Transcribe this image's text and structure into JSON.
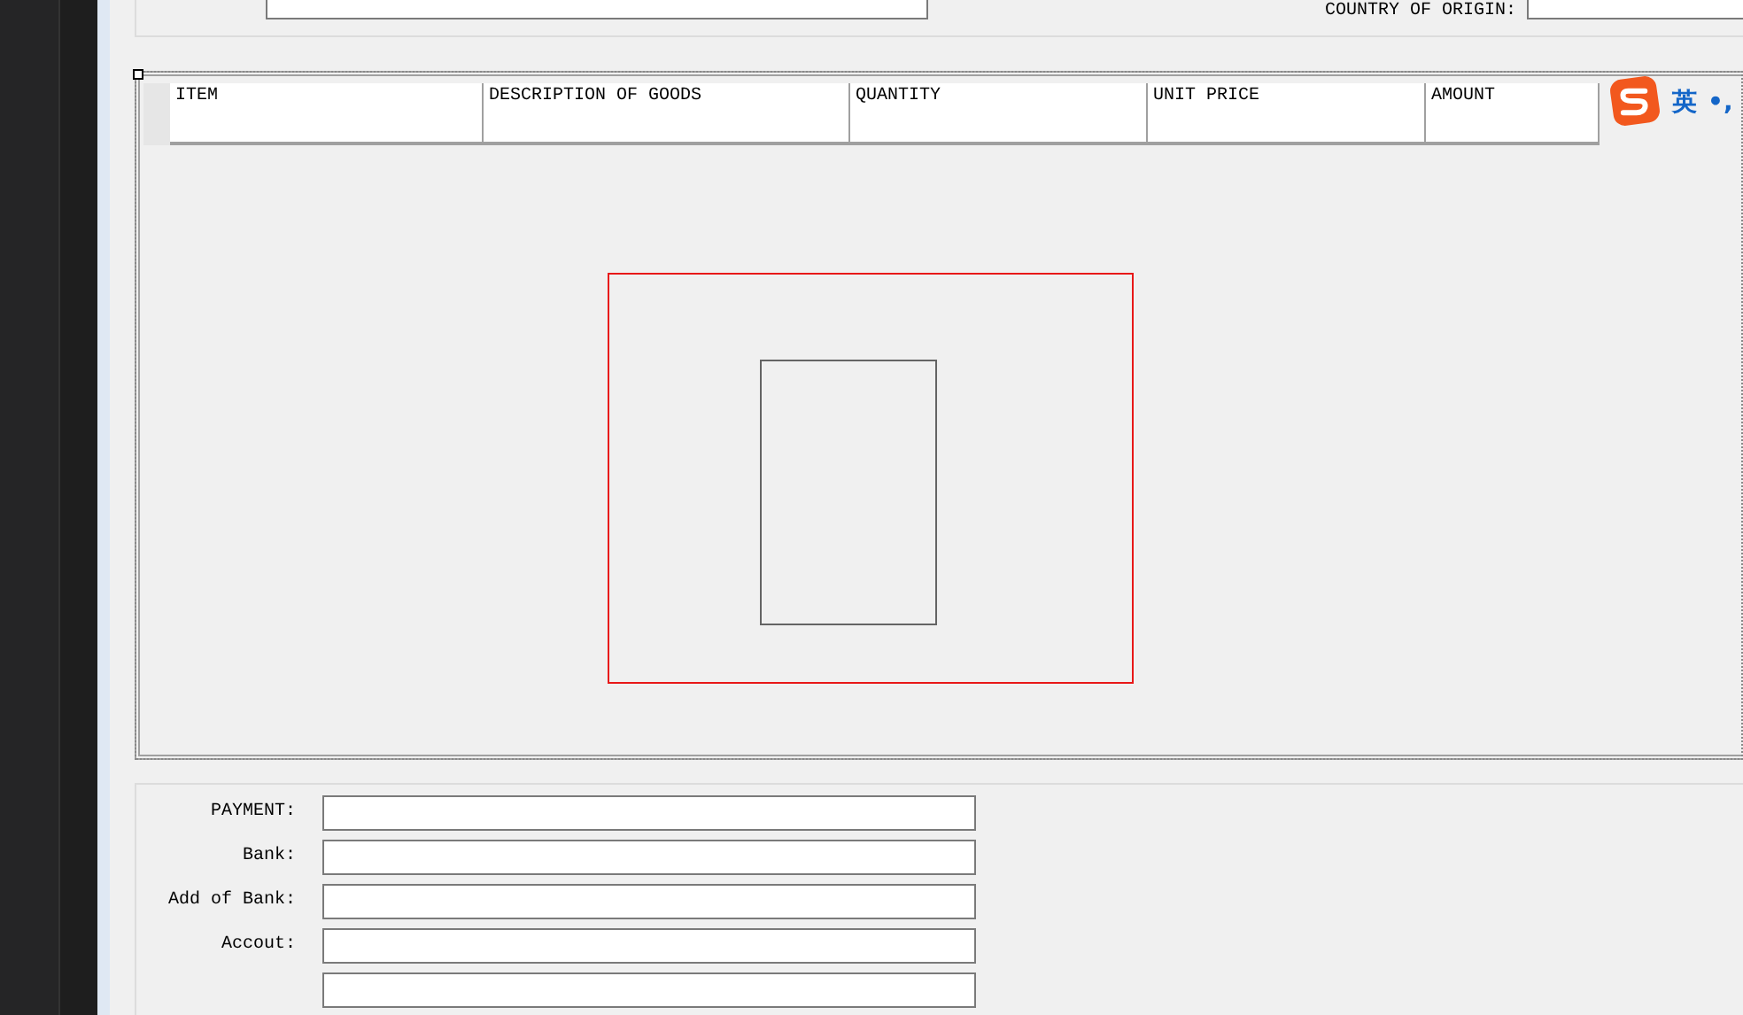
{
  "top_panel": {
    "origin_label": "COUNTRY OF ORIGIN:"
  },
  "table": {
    "columns": [
      "ITEM",
      "DESCRIPTION OF GOODS",
      "QUANTITY",
      "UNIT PRICE",
      "AMOUNT"
    ]
  },
  "payment_fields": [
    {
      "kind": "labeled",
      "label": "PAYMENT:"
    },
    {
      "kind": "labeled",
      "label": "Bank:"
    },
    {
      "kind": "labeled",
      "label": "Add of Bank:"
    },
    {
      "kind": "labeled",
      "label": "Accout:"
    },
    {
      "kind": "unlabeled"
    }
  ],
  "ime_toolbar": {
    "mode": "英",
    "punctuation": "•,"
  }
}
